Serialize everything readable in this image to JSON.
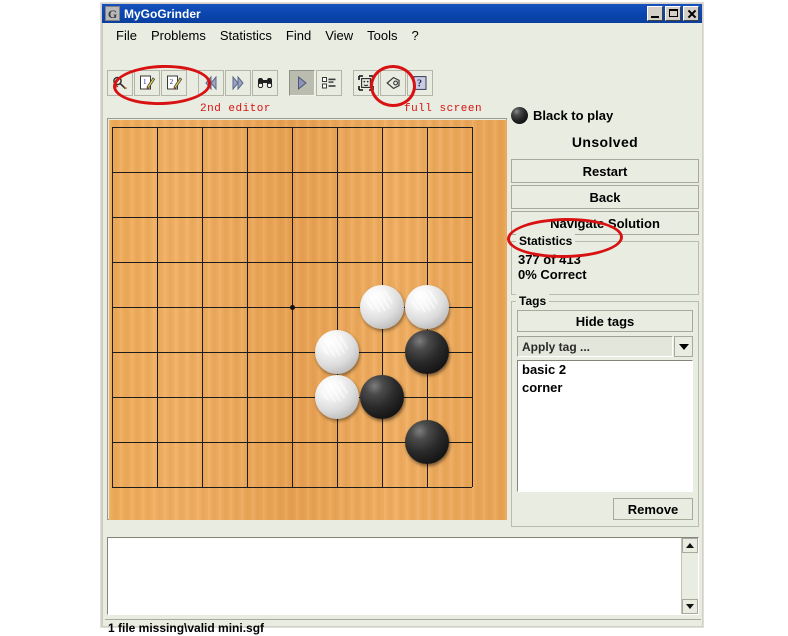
{
  "window": {
    "title": "MyGoGrinder",
    "icon": "app-logo-icon",
    "buttons": {
      "minimize": "_",
      "maximize": "□",
      "close": "✕"
    }
  },
  "menubar": {
    "items": [
      {
        "label": "File"
      },
      {
        "label": "Problems"
      },
      {
        "label": "Statistics"
      },
      {
        "label": "Find"
      },
      {
        "label": "View"
      },
      {
        "label": "Tools"
      },
      {
        "label": "?"
      }
    ]
  },
  "toolbar": {
    "buttons": [
      {
        "name": "magnifier-pencil-icon",
        "pressed": false
      },
      {
        "name": "editor-1-icon",
        "pressed": false
      },
      {
        "name": "editor-2-icon",
        "pressed": false
      },
      {
        "name": "previous-icon",
        "pressed": false
      },
      {
        "name": "next-icon",
        "pressed": false
      },
      {
        "name": "binoculars-icon",
        "pressed": false
      },
      {
        "name": "play-icon",
        "pressed": true
      },
      {
        "name": "list-icon",
        "pressed": false
      },
      {
        "name": "fullscreen-icon",
        "pressed": false
      },
      {
        "name": "tag-icon",
        "pressed": false
      },
      {
        "name": "help-icon",
        "pressed": false
      }
    ]
  },
  "annotations": {
    "color": "#d81212",
    "items": [
      {
        "text": "2nd editor"
      },
      {
        "text": "full screen"
      }
    ]
  },
  "board": {
    "size": 9,
    "wood_color": "#eeab5a",
    "line_color": "#1c1c1c",
    "star_points": [
      {
        "col": 5,
        "row": 5
      }
    ],
    "stones": [
      {
        "color": "white",
        "col": 7,
        "row": 5
      },
      {
        "color": "white",
        "col": 8,
        "row": 5
      },
      {
        "color": "white",
        "col": 6,
        "row": 6
      },
      {
        "color": "black",
        "col": 8,
        "row": 6
      },
      {
        "color": "white",
        "col": 6,
        "row": 7
      },
      {
        "color": "black",
        "col": 7,
        "row": 7
      },
      {
        "color": "black",
        "col": 8,
        "row": 8
      }
    ]
  },
  "sidebar": {
    "turn": {
      "label": "Black to play",
      "stone": "black"
    },
    "solve_status": "Unsolved",
    "buttons": [
      {
        "label": "Restart"
      },
      {
        "label": "Back"
      },
      {
        "label": "Navigate Solution"
      }
    ],
    "statistics": {
      "title": "Statistics",
      "progress": "377 of 413",
      "correct": "0% Correct"
    },
    "tags": {
      "title": "Tags",
      "toggle_label": "Hide tags",
      "combo_value": "Apply tag ...",
      "list": [
        "basic 2",
        "corner"
      ],
      "remove_label": "Remove"
    }
  },
  "comment": {
    "value": "",
    "placeholder": ""
  },
  "statusbar": {
    "text": "1 file missing\\valid mini.sgf"
  }
}
